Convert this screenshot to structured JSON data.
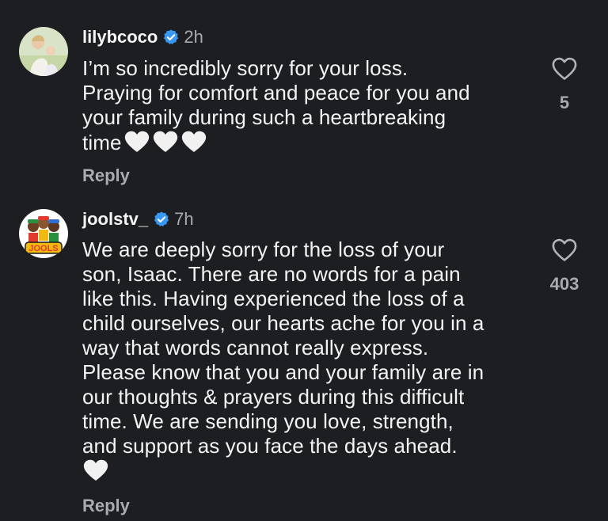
{
  "comments": [
    {
      "username": "lilybcoco",
      "time": "2h",
      "lines": [
        "I’m so incredibly sorry for your loss.",
        "Praying for comfort and peace for you and",
        "your family during such a heartbreaking",
        "time"
      ],
      "emoji": "🤍🤍🤍",
      "reply_label": "Reply",
      "likes": "5"
    },
    {
      "username": "joolstv_",
      "time": "7h",
      "lines": [
        "We are deeply sorry for the loss of your",
        "son, Isaac. There are no words for a pain",
        "like this. Having experienced the loss of a",
        "child ourselves, our hearts ache for you in a",
        "way that words cannot really express.",
        "Please know that you and your family are in",
        "our thoughts & prayers during this difficult",
        "time. We are sending you love, strength,",
        "and support as you face the days ahead."
      ],
      "emoji": "🤍",
      "reply_label": "Reply",
      "likes": "403",
      "avatar_logo_text": "JOOLS"
    }
  ],
  "icons": {
    "verified": "verified-badge-icon",
    "like": "heart-outline-icon",
    "emoji": "white-heart-emoji"
  },
  "colors": {
    "background": "#1c1e21",
    "verified": "#3897f0",
    "secondary_text": "#a8abb0"
  }
}
